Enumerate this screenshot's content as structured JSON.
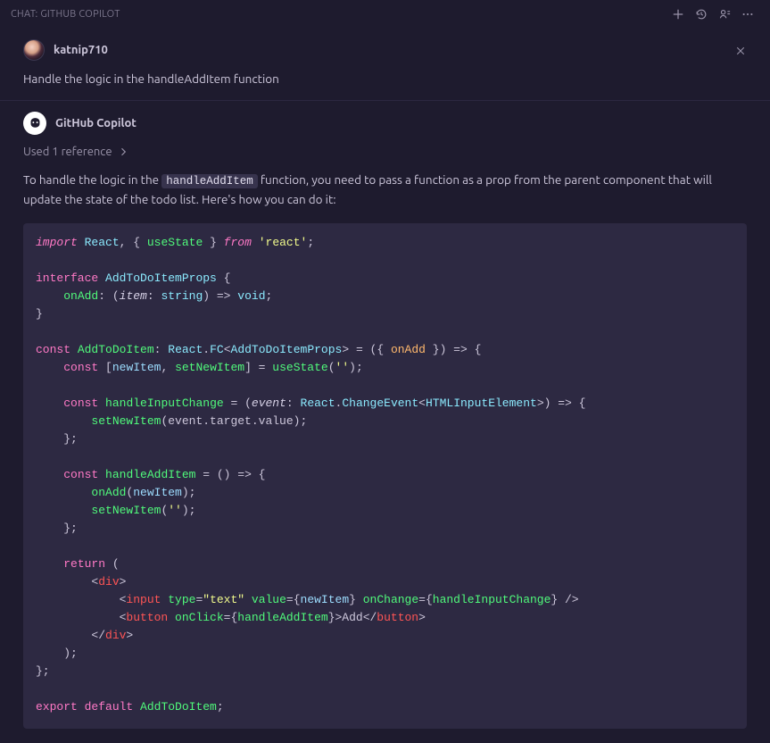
{
  "titlebar": {
    "label": "CHAT: GITHUB COPILOT"
  },
  "icons": {
    "new": "plus-icon",
    "history": "history-icon",
    "sidebar": "open-in-sidebar-icon",
    "more": "more-icon",
    "dismiss": "close-icon",
    "chevron": "chevron-right-icon"
  },
  "user_message": {
    "avatar_alt": "user-avatar",
    "username": "katnip710",
    "text": "Handle the logic in the handleAddItem function"
  },
  "assistant_message": {
    "avatar_alt": "copilot-avatar",
    "name": "GitHub Copilot",
    "references_label": "Used 1 reference",
    "response_prefix": "To handle the logic in the ",
    "inline_ref": "handleAddItem",
    "response_suffix": " function, you need to pass a function as a prop from the parent component that will update the state of the todo list. Here's how you can do it:"
  },
  "code": {
    "language": "tsx",
    "tokens": [
      [
        "k",
        "import"
      ],
      [
        "p",
        " "
      ],
      [
        "t",
        "React"
      ],
      [
        "p",
        ", { "
      ],
      [
        "f",
        "useState"
      ],
      [
        "p",
        " } "
      ],
      [
        "k",
        "from"
      ],
      [
        "p",
        " "
      ],
      [
        "s",
        "'react'"
      ],
      [
        "p",
        ";\n\n"
      ],
      [
        "kn",
        "interface"
      ],
      [
        "p",
        " "
      ],
      [
        "t",
        "AddToDoItemProps"
      ],
      [
        "p",
        " {\n    "
      ],
      [
        "f",
        "onAdd"
      ],
      [
        "p",
        ": ("
      ],
      [
        "i",
        "item"
      ],
      [
        "p",
        ": "
      ],
      [
        "t",
        "string"
      ],
      [
        "p",
        ") => "
      ],
      [
        "t",
        "void"
      ],
      [
        "p",
        ";\n}\n\n"
      ],
      [
        "kn",
        "const"
      ],
      [
        "p",
        " "
      ],
      [
        "f",
        "AddToDoItem"
      ],
      [
        "p",
        ": "
      ],
      [
        "t",
        "React"
      ],
      [
        "p",
        "."
      ],
      [
        "t",
        "FC"
      ],
      [
        "p",
        "<"
      ],
      [
        "t",
        "AddToDoItemProps"
      ],
      [
        "p",
        "> = ({ "
      ],
      [
        "o",
        "onAdd"
      ],
      [
        "p",
        " }) => {\n    "
      ],
      [
        "kn",
        "const"
      ],
      [
        "p",
        " ["
      ],
      [
        "v",
        "newItem"
      ],
      [
        "p",
        ", "
      ],
      [
        "f",
        "setNewItem"
      ],
      [
        "p",
        "] = "
      ],
      [
        "f",
        "useState"
      ],
      [
        "p",
        "("
      ],
      [
        "s",
        "''"
      ],
      [
        "p",
        ");\n\n    "
      ],
      [
        "kn",
        "const"
      ],
      [
        "p",
        " "
      ],
      [
        "f",
        "handleInputChange"
      ],
      [
        "p",
        " = ("
      ],
      [
        "i",
        "event"
      ],
      [
        "p",
        ": "
      ],
      [
        "t",
        "React"
      ],
      [
        "p",
        "."
      ],
      [
        "t",
        "ChangeEvent"
      ],
      [
        "p",
        "<"
      ],
      [
        "t",
        "HTMLInputElement"
      ],
      [
        "p",
        ">) => {\n        "
      ],
      [
        "f",
        "setNewItem"
      ],
      [
        "p",
        "(event.target.value);\n    };\n\n    "
      ],
      [
        "kn",
        "const"
      ],
      [
        "p",
        " "
      ],
      [
        "f",
        "handleAddItem"
      ],
      [
        "p",
        " = () => {\n        "
      ],
      [
        "f",
        "onAdd"
      ],
      [
        "p",
        "("
      ],
      [
        "v",
        "newItem"
      ],
      [
        "p",
        ");\n        "
      ],
      [
        "f",
        "setNewItem"
      ],
      [
        "p",
        "("
      ],
      [
        "s",
        "''"
      ],
      [
        "p",
        ");\n    };\n\n    "
      ],
      [
        "kn",
        "return"
      ],
      [
        "p",
        " (\n        <"
      ],
      [
        "tg",
        "div"
      ],
      [
        "p",
        ">\n            <"
      ],
      [
        "tg",
        "input"
      ],
      [
        "p",
        " "
      ],
      [
        "a",
        "type"
      ],
      [
        "p",
        "="
      ],
      [
        "s",
        "\"text\""
      ],
      [
        "p",
        " "
      ],
      [
        "a",
        "value"
      ],
      [
        "p",
        "={"
      ],
      [
        "v",
        "newItem"
      ],
      [
        "p",
        "} "
      ],
      [
        "a",
        "onChange"
      ],
      [
        "p",
        "={"
      ],
      [
        "f",
        "handleInputChange"
      ],
      [
        "p",
        "} />\n            <"
      ],
      [
        "tg",
        "button"
      ],
      [
        "p",
        " "
      ],
      [
        "a",
        "onClick"
      ],
      [
        "p",
        "={"
      ],
      [
        "f",
        "handleAddItem"
      ],
      [
        "p",
        "}>Add</"
      ],
      [
        "tg",
        "button"
      ],
      [
        "p",
        ">\n        </"
      ],
      [
        "tg",
        "div"
      ],
      [
        "p",
        ">\n    );\n};\n\n"
      ],
      [
        "kn",
        "export"
      ],
      [
        "p",
        " "
      ],
      [
        "kn",
        "default"
      ],
      [
        "p",
        " "
      ],
      [
        "f",
        "AddToDoItem"
      ],
      [
        "p",
        ";"
      ]
    ]
  }
}
